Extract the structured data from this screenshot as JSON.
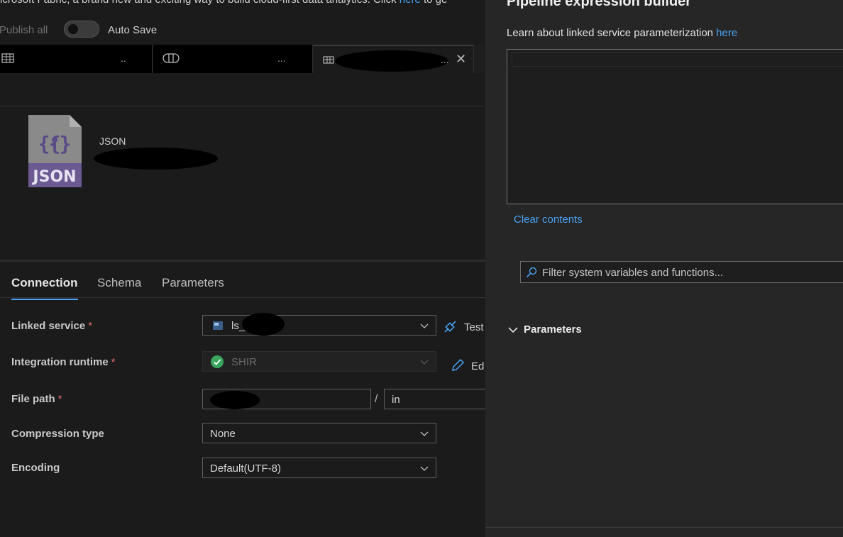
{
  "banner": {
    "text": "icrosoft Fabric, a brand new and exciting way to build cloud-first data analytics. Click ",
    "link": "here",
    "suffix": " to ge"
  },
  "toolbar": {
    "publish_label": "Publish all",
    "autosave_label": "Auto Save",
    "autosave_on": false
  },
  "tabs": [
    {
      "icon": "table-icon",
      "title_redacted": true,
      "overflow": ".."
    },
    {
      "icon": "pipeline-icon",
      "title_redacted": true,
      "overflow": "..."
    },
    {
      "icon": "dataset-icon",
      "title_redacted": true,
      "overflow": "...",
      "close": "✕"
    }
  ],
  "dataset": {
    "icon_label": "JSON",
    "type": "JSON"
  },
  "subtabs": [
    "Connection",
    "Schema",
    "Parameters"
  ],
  "form": {
    "linked_service": {
      "label": "Linked service",
      "required": "*",
      "value": "ls_",
      "side_button": "Test"
    },
    "integration_runtime": {
      "label": "Integration runtime",
      "required": "*",
      "value": "SHIR",
      "side_button": "Ed"
    },
    "file_path": {
      "label": "File path",
      "required": "*",
      "container": "",
      "separator": "/",
      "directory": "in"
    },
    "compression_type": {
      "label": "Compression type",
      "value": "None"
    },
    "encoding": {
      "label": "Encoding",
      "value": "Default(UTF-8)"
    }
  },
  "expression_builder": {
    "title": "Pipeline expression builder",
    "learn_text": "Learn about linked service parameterization ",
    "learn_link": "here",
    "clear_label": "Clear contents",
    "filter_placeholder": "Filter system variables and functions...",
    "parameters_label": "Parameters"
  },
  "colors": {
    "accent": "#4aa0f0",
    "required": "#e06c6c",
    "success": "#3aa55d",
    "json_icon_purple": "#6b5a92"
  }
}
